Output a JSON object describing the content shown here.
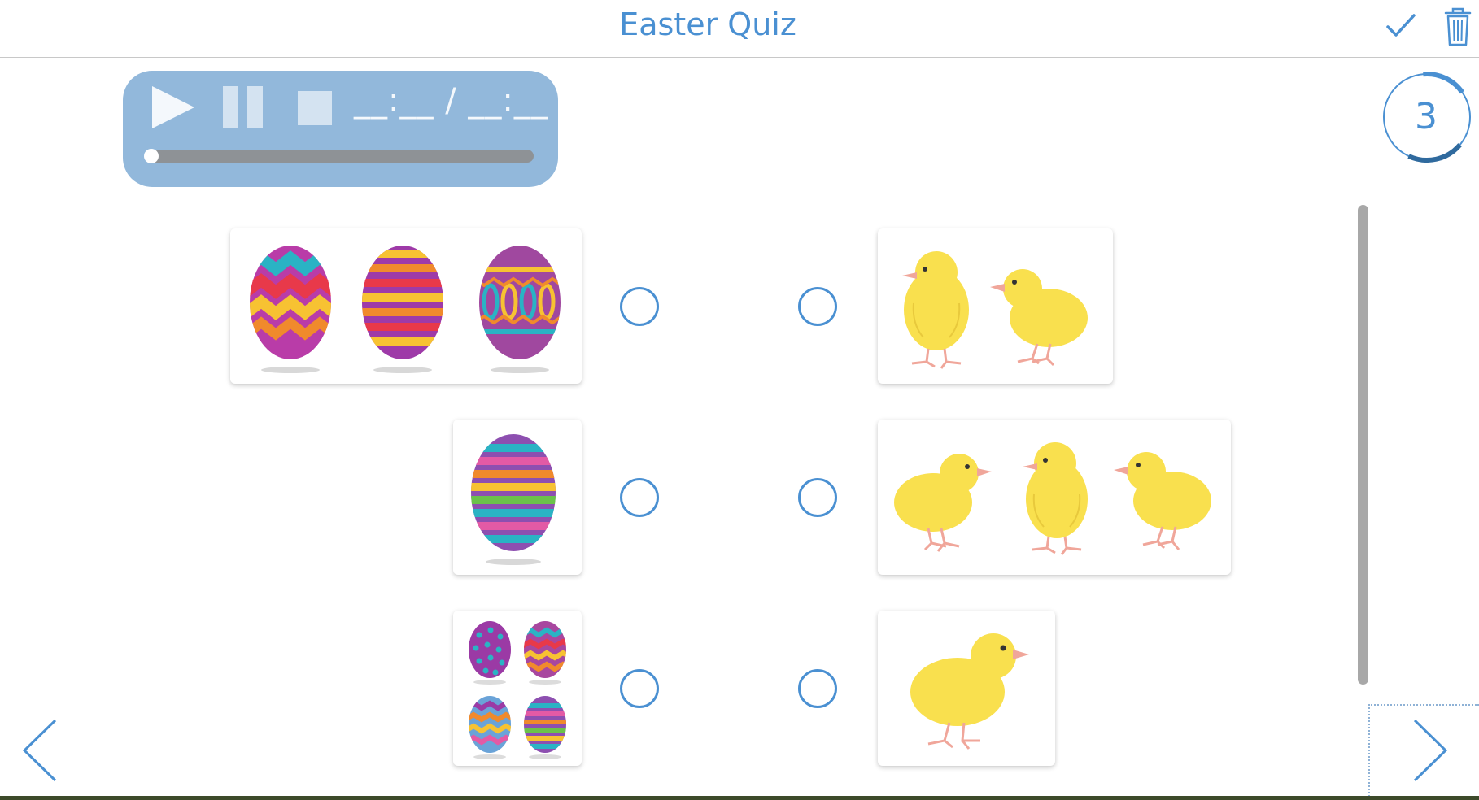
{
  "header": {
    "title": "Easter Quiz"
  },
  "player": {
    "time": "__:__ / __:__",
    "progress": 0
  },
  "counter": {
    "value": "3",
    "progress_fraction": 0.55
  },
  "colors": {
    "accent": "#4a90d2",
    "player_bg": "#92b8db",
    "chick": "#f9e04e",
    "chick_leg": "#f0a69a"
  },
  "left_items": [
    {
      "content": "three decorated Easter eggs"
    },
    {
      "content": "one striped Easter egg"
    },
    {
      "content": "four small Easter eggs"
    }
  ],
  "right_items": [
    {
      "content": "two yellow chicks"
    },
    {
      "content": "three yellow chicks"
    },
    {
      "content": "one yellow chick"
    }
  ],
  "icons": [
    "check-icon",
    "trash-icon",
    "play-icon",
    "pause-icon",
    "stop-icon",
    "chevron-left-icon",
    "chevron-right-icon"
  ]
}
